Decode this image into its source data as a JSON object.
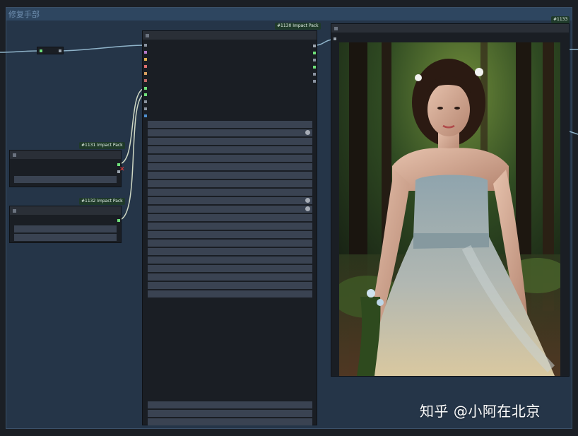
{
  "group": {
    "title": "修复手部"
  },
  "nodes": {
    "impact_1130": {
      "badge": "#1130 Impact Pack"
    },
    "impact_1131": {
      "badge": "#1131 Impact Pack"
    },
    "impact_1132": {
      "badge": "#1132 Impact Pack"
    },
    "preview_1133": {
      "badge": "#1133"
    }
  },
  "watermark": {
    "text": "知乎 @小阿在北京"
  },
  "colors": {
    "canvas": "#1b1f25",
    "group_body": "#253548",
    "group_header": "#2e4660",
    "node_body": "#1a1e24",
    "widget": "#3a4352",
    "link": "#8fb3c9",
    "link_light": "#cfd8c4",
    "slot_green": "#6fe07a",
    "error_x": "#ff3b3b"
  },
  "icons": [
    "collapse-dot-icon",
    "error-x-icon"
  ]
}
